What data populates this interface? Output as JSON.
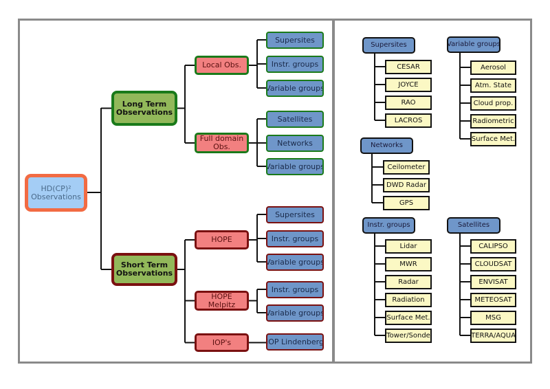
{
  "left_tree": {
    "root": "HD(CP)² Observations",
    "long_term": {
      "label": "Long Term Observations",
      "children": [
        {
          "label": "Local Obs.",
          "leaves": [
            "Supersites",
            "Instr. groups",
            "Variable groups"
          ]
        },
        {
          "label": "Full domain Obs.",
          "leaves": [
            "Satellites",
            "Networks",
            "Variable groups"
          ]
        }
      ]
    },
    "short_term": {
      "label": "Short Term Observations",
      "children": [
        {
          "label": "HOPE",
          "leaves": [
            "Supersites",
            "Instr. groups",
            "Variable groups"
          ]
        },
        {
          "label": "HOPE Melpitz",
          "leaves": [
            "Instr. groups",
            "Variable groups"
          ]
        },
        {
          "label": "IOP's",
          "leaves": [
            "IOP Lindenberg"
          ]
        }
      ]
    }
  },
  "right_groups": [
    {
      "label": "Supersites",
      "items": [
        "CESAR",
        "JOYCE",
        "RAO",
        "LACROS"
      ]
    },
    {
      "label": "Variable groups",
      "items": [
        "Aerosol",
        "Atm. State",
        "Cloud prop.",
        "Radiometric",
        "Surface Met."
      ]
    },
    {
      "label": "Networks",
      "items": [
        "Ceilometer",
        "DWD Radar",
        "GPS"
      ]
    },
    {
      "label": "Instr. groups",
      "items": [
        "Lidar",
        "MWR",
        "Radar",
        "Radiation",
        "Surface Met.",
        "Tower/Sonde"
      ]
    },
    {
      "label": "Satellites",
      "items": [
        "CALIPSO",
        "CLOUDSAT",
        "ENVISAT",
        "METEOSAT",
        "MSG",
        "TERRA/AQUA"
      ]
    }
  ],
  "colors": {
    "root_fill": "#a4cdf5",
    "root_border": "#f26b43",
    "category_fill": "#92b85a",
    "long_term_border": "#1a7a1a",
    "short_term_border": "#7a1010",
    "sub_fill": "#f28080",
    "leaf_fill": "#6f96c9",
    "item_fill": "#fbf8c4",
    "line": "#111111"
  }
}
